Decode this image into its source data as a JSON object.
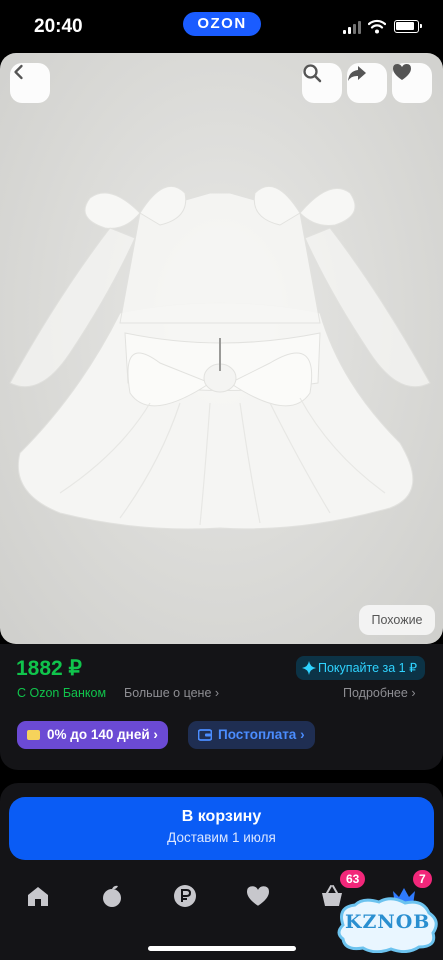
{
  "status_bar": {
    "time": "20:40",
    "logo": "OZON"
  },
  "product": {
    "similar_label": "Похожие",
    "price": "1882 ₽",
    "price_note": "С Ozon Банком",
    "more_about_price": "Больше о цене",
    "details_link": "Подробнее",
    "promo": "Покупайте за 1 ₽",
    "installment": "0% до 140 дней",
    "postpay": "Постоплата"
  },
  "cart": {
    "label": "В корзину",
    "delivery": "Доставим 1 июля"
  },
  "tabbar": {
    "items": [
      "home-icon",
      "fresh-icon",
      "finance-icon",
      "favorites-icon",
      "cart-icon",
      "profile-crown-icon"
    ],
    "cart_badge": "63",
    "profile_badge": "7"
  },
  "watermark": "KZNOB",
  "colors": {
    "accent_blue": "#0a5cf5",
    "price_green": "#10c44c",
    "badge_pink": "#f2277a",
    "installment_purple": "#6b4ad4"
  }
}
